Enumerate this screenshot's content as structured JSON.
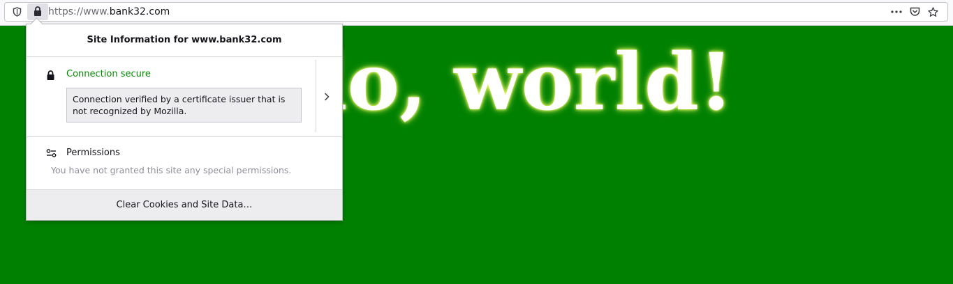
{
  "browser": {
    "url_protocol": "https://www.",
    "url_host": "bank32.com",
    "icons": [
      "tracking-protection-shield-icon",
      "lock-icon",
      "more-icon",
      "pocket-icon",
      "bookmark-star-icon"
    ]
  },
  "page": {
    "heading": "lo, world!",
    "background_color": "#008000"
  },
  "site_info_panel": {
    "title": "Site Information for www.bank32.com",
    "connection_label": "Connection secure",
    "connection_color": "#058b00",
    "certificate_note": "Connection verified by a certificate issuer that is not recognized by Mozilla.",
    "permissions_label": "Permissions",
    "permissions_note": "You have not granted this site any special permissions.",
    "clear_button": "Clear Cookies and Site Data…"
  }
}
